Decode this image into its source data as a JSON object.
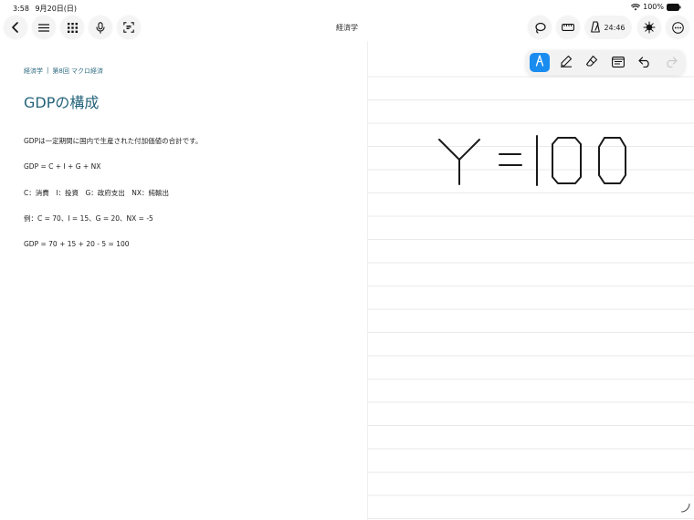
{
  "status": {
    "time": "3:58",
    "date": "9月20日(日)",
    "battery": "100%"
  },
  "toolbar": {
    "document_title": "経済学",
    "timer": "24:46"
  },
  "note": {
    "breadcrumb_subject": "経済学",
    "breadcrumb_separator": "|",
    "breadcrumb_lecture": "第8回 マクロ経済",
    "heading": "GDPの構成",
    "lines": [
      "GDPは一定期間に国内で生産された付加価値の合計です。",
      "GDP = C + I + G + NX",
      "C：消費　I：投資　G：政府支出　NX：純輸出",
      "例：C = 70、I = 15、G = 20、NX = -5",
      "GDP = 70 + 15 + 20 - 5 = 100"
    ]
  },
  "pen_tools": {
    "active_tool": "fountain-pen",
    "accent": "#1a8cf0"
  },
  "handwriting": {
    "text": "Y=100",
    "stroke_color": "#1a1a1a"
  },
  "colors": {
    "heading": "#24637a",
    "breadcrumb": "#2d6a7f"
  }
}
